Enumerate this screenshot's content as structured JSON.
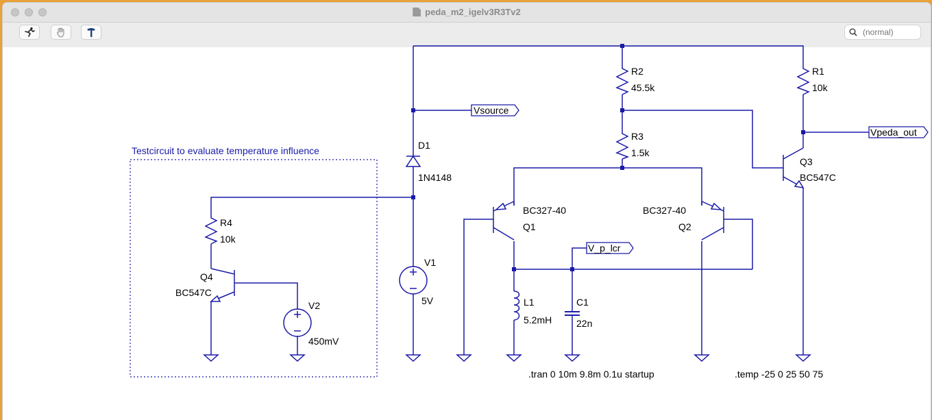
{
  "window": {
    "title": "peda_m2_igelv3R3Tv2"
  },
  "toolbar": {
    "tools": [
      {
        "icon": "run-icon"
      },
      {
        "icon": "hand-icon"
      },
      {
        "icon": "hammer-icon"
      }
    ],
    "search_placeholder": "(normal)"
  },
  "schematic": {
    "box_label": "Testcircuit to evaluate temperature influence",
    "components": {
      "R1": {
        "name": "R1",
        "value": "10k"
      },
      "R2": {
        "name": "R2",
        "value": "45.5k"
      },
      "R3": {
        "name": "R3",
        "value": "1.5k"
      },
      "R4": {
        "name": "R4",
        "value": "10k"
      },
      "D1": {
        "name": "D1",
        "value": "1N4148"
      },
      "V1": {
        "name": "V1",
        "value": "5V"
      },
      "V2": {
        "name": "V2",
        "value": "450mV"
      },
      "Q1": {
        "name": "Q1",
        "model": "BC327-40"
      },
      "Q2": {
        "name": "Q2",
        "model": "BC327-40"
      },
      "Q3": {
        "name": "Q3",
        "model": "BC547C"
      },
      "Q4": {
        "name": "Q4",
        "model": "BC547C"
      },
      "L1": {
        "name": "L1",
        "value": "5.2mH"
      },
      "C1": {
        "name": "C1",
        "value": "22n"
      }
    },
    "net_labels": {
      "vsource": "Vsource",
      "vpeda_out": "Vpeda_out",
      "v_p_lcr": "V_p_lcr"
    },
    "directives": {
      "tran": ".tran 0 10m 9.8m 0.1u startup",
      "temp": ".temp  -25 0 25 50 75"
    }
  },
  "colors": {
    "wire": "#1a1aa8",
    "background": "#ffffff",
    "label": "#000000",
    "box_label": "#1a1aa8",
    "accent_border": "#e9a13a"
  }
}
